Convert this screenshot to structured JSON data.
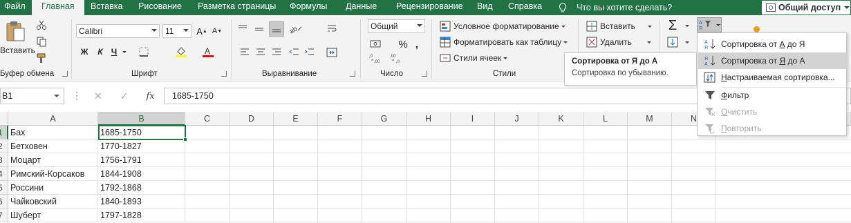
{
  "tabs": {
    "file": "Файл",
    "home": "Главная",
    "insert": "Вставка",
    "draw": "Рисование",
    "page_layout": "Разметка страницы",
    "formulas": "Формулы",
    "data": "Данные",
    "review": "Рецензирование",
    "view": "Вид",
    "help": "Справка",
    "tell_me": "Что вы хотите сделать?",
    "share": "Общий доступ"
  },
  "ribbon": {
    "clipboard": {
      "label": "Буфер обмена",
      "paste": "Вставить"
    },
    "font": {
      "label": "Шрифт",
      "font_name": "Calibri",
      "font_size": "11",
      "bold": "Ж",
      "italic": "К",
      "underline": "Ч"
    },
    "alignment": {
      "label": "Выравнивание"
    },
    "number": {
      "label": "Число",
      "format": "Общий"
    },
    "styles": {
      "label": "Стили",
      "conditional": "Условное форматирование",
      "format_table": "Форматировать как таблицу",
      "cell_styles": "Стили ячеек"
    },
    "cells": {
      "insert": "Вставить",
      "delete": "Удалить"
    }
  },
  "formula_bar": {
    "name_box": "B1",
    "fx": "fx",
    "value": "1685-1750"
  },
  "grid": {
    "columns": [
      "A",
      "B",
      "C",
      "D",
      "E",
      "F",
      "G",
      "H",
      "I",
      "J",
      "K",
      "L",
      "M",
      "N"
    ],
    "row_numbers": [
      "1",
      "2",
      "3",
      "4",
      "5",
      "6",
      "7"
    ],
    "rows": [
      {
        "a": "Бах",
        "b": "1685-1750"
      },
      {
        "a": "Бетховен",
        "b": "1770-1827"
      },
      {
        "a": "Моцарт",
        "b": "1756-1791"
      },
      {
        "a": "Римский-Корсаков",
        "b": "1844-1908"
      },
      {
        "a": "Россини",
        "b": "1792-1868"
      },
      {
        "a": "Чайковский",
        "b": "1840-1893"
      },
      {
        "a": "Шуберт",
        "b": "1797-1828"
      }
    ]
  },
  "tooltip": {
    "title": "Сортировка от Я до А",
    "description": "Сортировка по убыванию."
  },
  "sort_menu": {
    "items": [
      {
        "pre": "Сортировка от ",
        "u": "А",
        "post": " до Я"
      },
      {
        "pre": "Сортировка от ",
        "u": "Я",
        "post": " до А"
      },
      {
        "pre": "",
        "u": "Н",
        "post": "астраиваемая сортировка..."
      },
      {
        "pre": "",
        "u": "Ф",
        "post": "ильтр"
      },
      {
        "pre": "",
        "u": "О",
        "post": "чистить"
      },
      {
        "pre": "",
        "u": "П",
        "post": "овторить"
      }
    ]
  },
  "colors": {
    "accent": "#217346",
    "ribbon_bg": "#f3f3f3",
    "menu_hover": "#d3d3d3"
  }
}
